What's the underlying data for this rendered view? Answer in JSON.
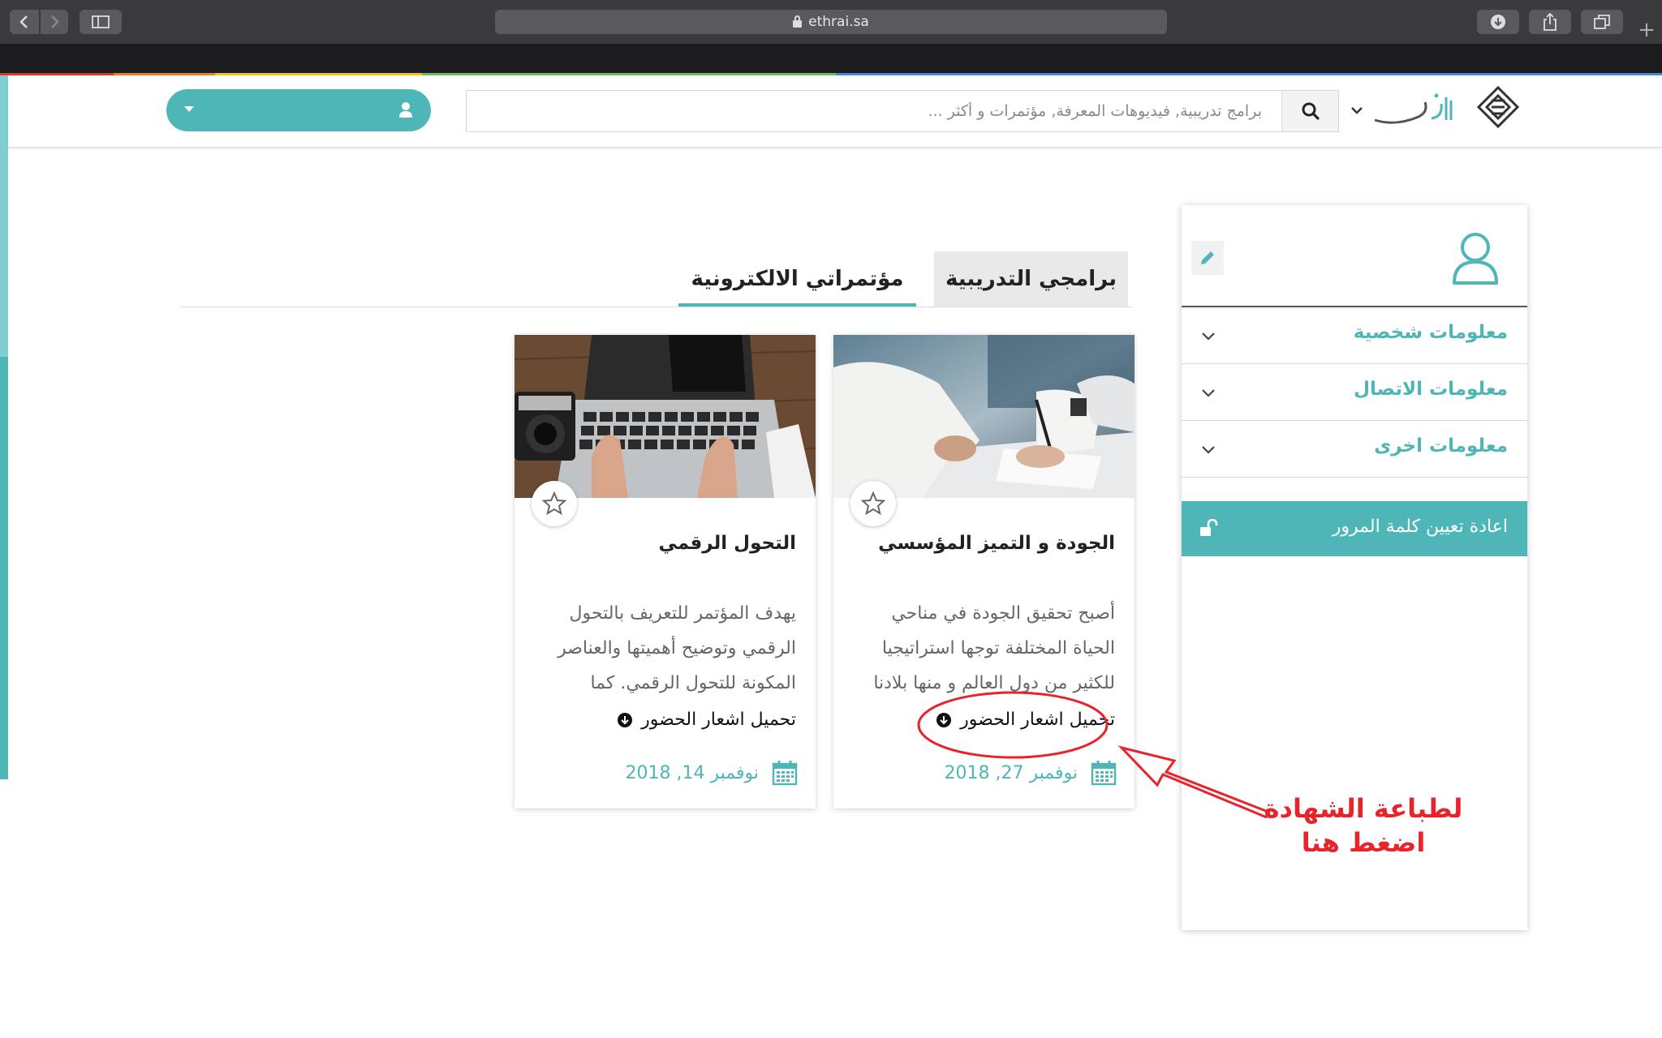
{
  "browser": {
    "url": "ethrai.sa",
    "back_icon": "chevron-left-icon",
    "forward_icon": "chevron-right-icon",
    "plus": "+"
  },
  "header": {
    "search_placeholder": "برامج تدريبية, فيديوهات المعرفة, مؤتمرات و أكثر ...",
    "accent_color": "#4fb6b8"
  },
  "sidebar": {
    "items": [
      {
        "label": "معلومات شخصية"
      },
      {
        "label": "معلومات الاتصال"
      },
      {
        "label": "معلومات اخرى"
      }
    ],
    "reset_password": "اعادة تعيين كلمة المرور"
  },
  "tabs": [
    {
      "label": "برامجي التدريبية",
      "active": false
    },
    {
      "label": "مؤتمراتي الالكترونية",
      "active": true
    }
  ],
  "cards": [
    {
      "title": "الجودة و التميز المؤسسي",
      "description": "أصبح تحقيق الجودة في مناحي الحياة المختلفة توجها استراتيجيا للكثير من دول العالم و منها بلادنا",
      "download": "تحميل اشعار الحضور",
      "date": "نوفمبر 27, 2018"
    },
    {
      "title": "التحول الرقمي",
      "description": "يهدف المؤتمر للتعريف بالتحول الرقمي وتوضيح أهميتها والعناصر المكونة للتحول الرقمي. كما",
      "download": "تحميل اشعار الحضور",
      "date": "نوفمبر 14, 2018"
    }
  ],
  "annotation": {
    "line1": "لطباعة الشهادة",
    "line2": "اضغط هنا",
    "color": "#e8232a"
  }
}
